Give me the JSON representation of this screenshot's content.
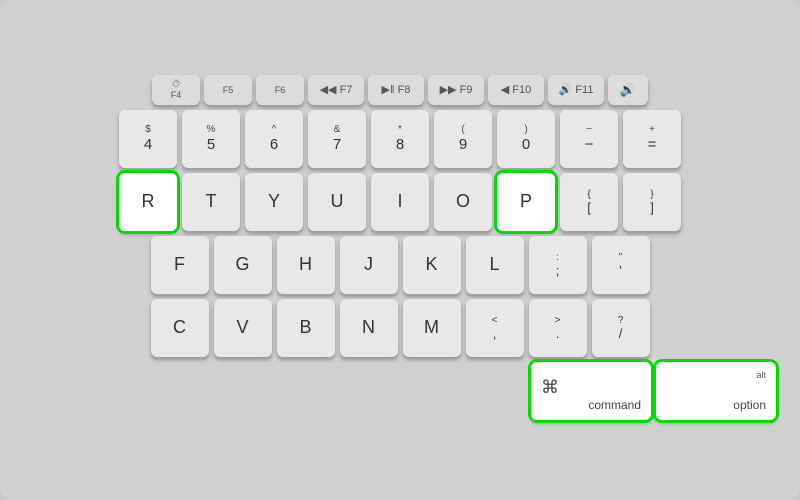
{
  "keyboard": {
    "bg": "#d0d0d0",
    "highlighted_keys": [
      "R",
      "P",
      "command",
      "option"
    ],
    "rows": {
      "fn_row": {
        "keys": [
          {
            "label": "F4",
            "sub": "⏱",
            "type": "fn"
          },
          {
            "label": "F5",
            "type": "fn"
          },
          {
            "label": "F6",
            "type": "fn"
          },
          {
            "label": "◀◀",
            "sub": "F7",
            "type": "fn_media"
          },
          {
            "label": "▶‖",
            "sub": "F8",
            "type": "fn_media"
          },
          {
            "label": "▶▶",
            "sub": "F9",
            "type": "fn_media"
          },
          {
            "label": "◀",
            "sub": "F10",
            "type": "fn_media"
          },
          {
            "label": "🔊",
            "sub": "F11",
            "type": "fn_media"
          },
          {
            "label": "🔊+",
            "sub": "",
            "type": "fn_media"
          }
        ]
      },
      "number_row": {
        "keys": [
          {
            "top": "$",
            "bot": "4"
          },
          {
            "top": "%",
            "bot": "5"
          },
          {
            "top": "^",
            "bot": "6"
          },
          {
            "top": "&",
            "bot": "7"
          },
          {
            "top": "*",
            "bot": "8"
          },
          {
            "top": "(",
            "bot": "9"
          },
          {
            "top": ")",
            "bot": "0"
          },
          {
            "top": "−",
            "bot": "−"
          },
          {
            "top": "+",
            "bot": "="
          }
        ]
      },
      "qwerty_row": {
        "keys": [
          {
            "label": "R",
            "highlight": true
          },
          {
            "label": "T"
          },
          {
            "label": "Y"
          },
          {
            "label": "U"
          },
          {
            "label": "I"
          },
          {
            "label": "O"
          },
          {
            "label": "P",
            "highlight": true
          },
          {
            "top": "{",
            "bot": "["
          },
          {
            "top": "}",
            "bot": "]"
          }
        ]
      },
      "asdf_row": {
        "keys": [
          {
            "label": "F"
          },
          {
            "label": "G"
          },
          {
            "label": "H"
          },
          {
            "label": "J"
          },
          {
            "label": "K"
          },
          {
            "label": "L"
          },
          {
            "top": ":",
            "bot": ";"
          },
          {
            "top": "\"",
            "bot": "'"
          }
        ]
      },
      "zxcv_row": {
        "keys": [
          {
            "label": "C"
          },
          {
            "label": "V"
          },
          {
            "label": "B"
          },
          {
            "label": "N"
          },
          {
            "label": "M"
          },
          {
            "top": "<",
            "bot": ","
          },
          {
            "top": ">",
            "bot": "."
          },
          {
            "top": "?",
            "bot": "/"
          }
        ]
      },
      "bottom_row": {
        "command": {
          "symbol": "⌘",
          "label": "command",
          "highlight": true
        },
        "option": {
          "alt": "alt",
          "label": "option",
          "highlight": true
        }
      }
    }
  }
}
